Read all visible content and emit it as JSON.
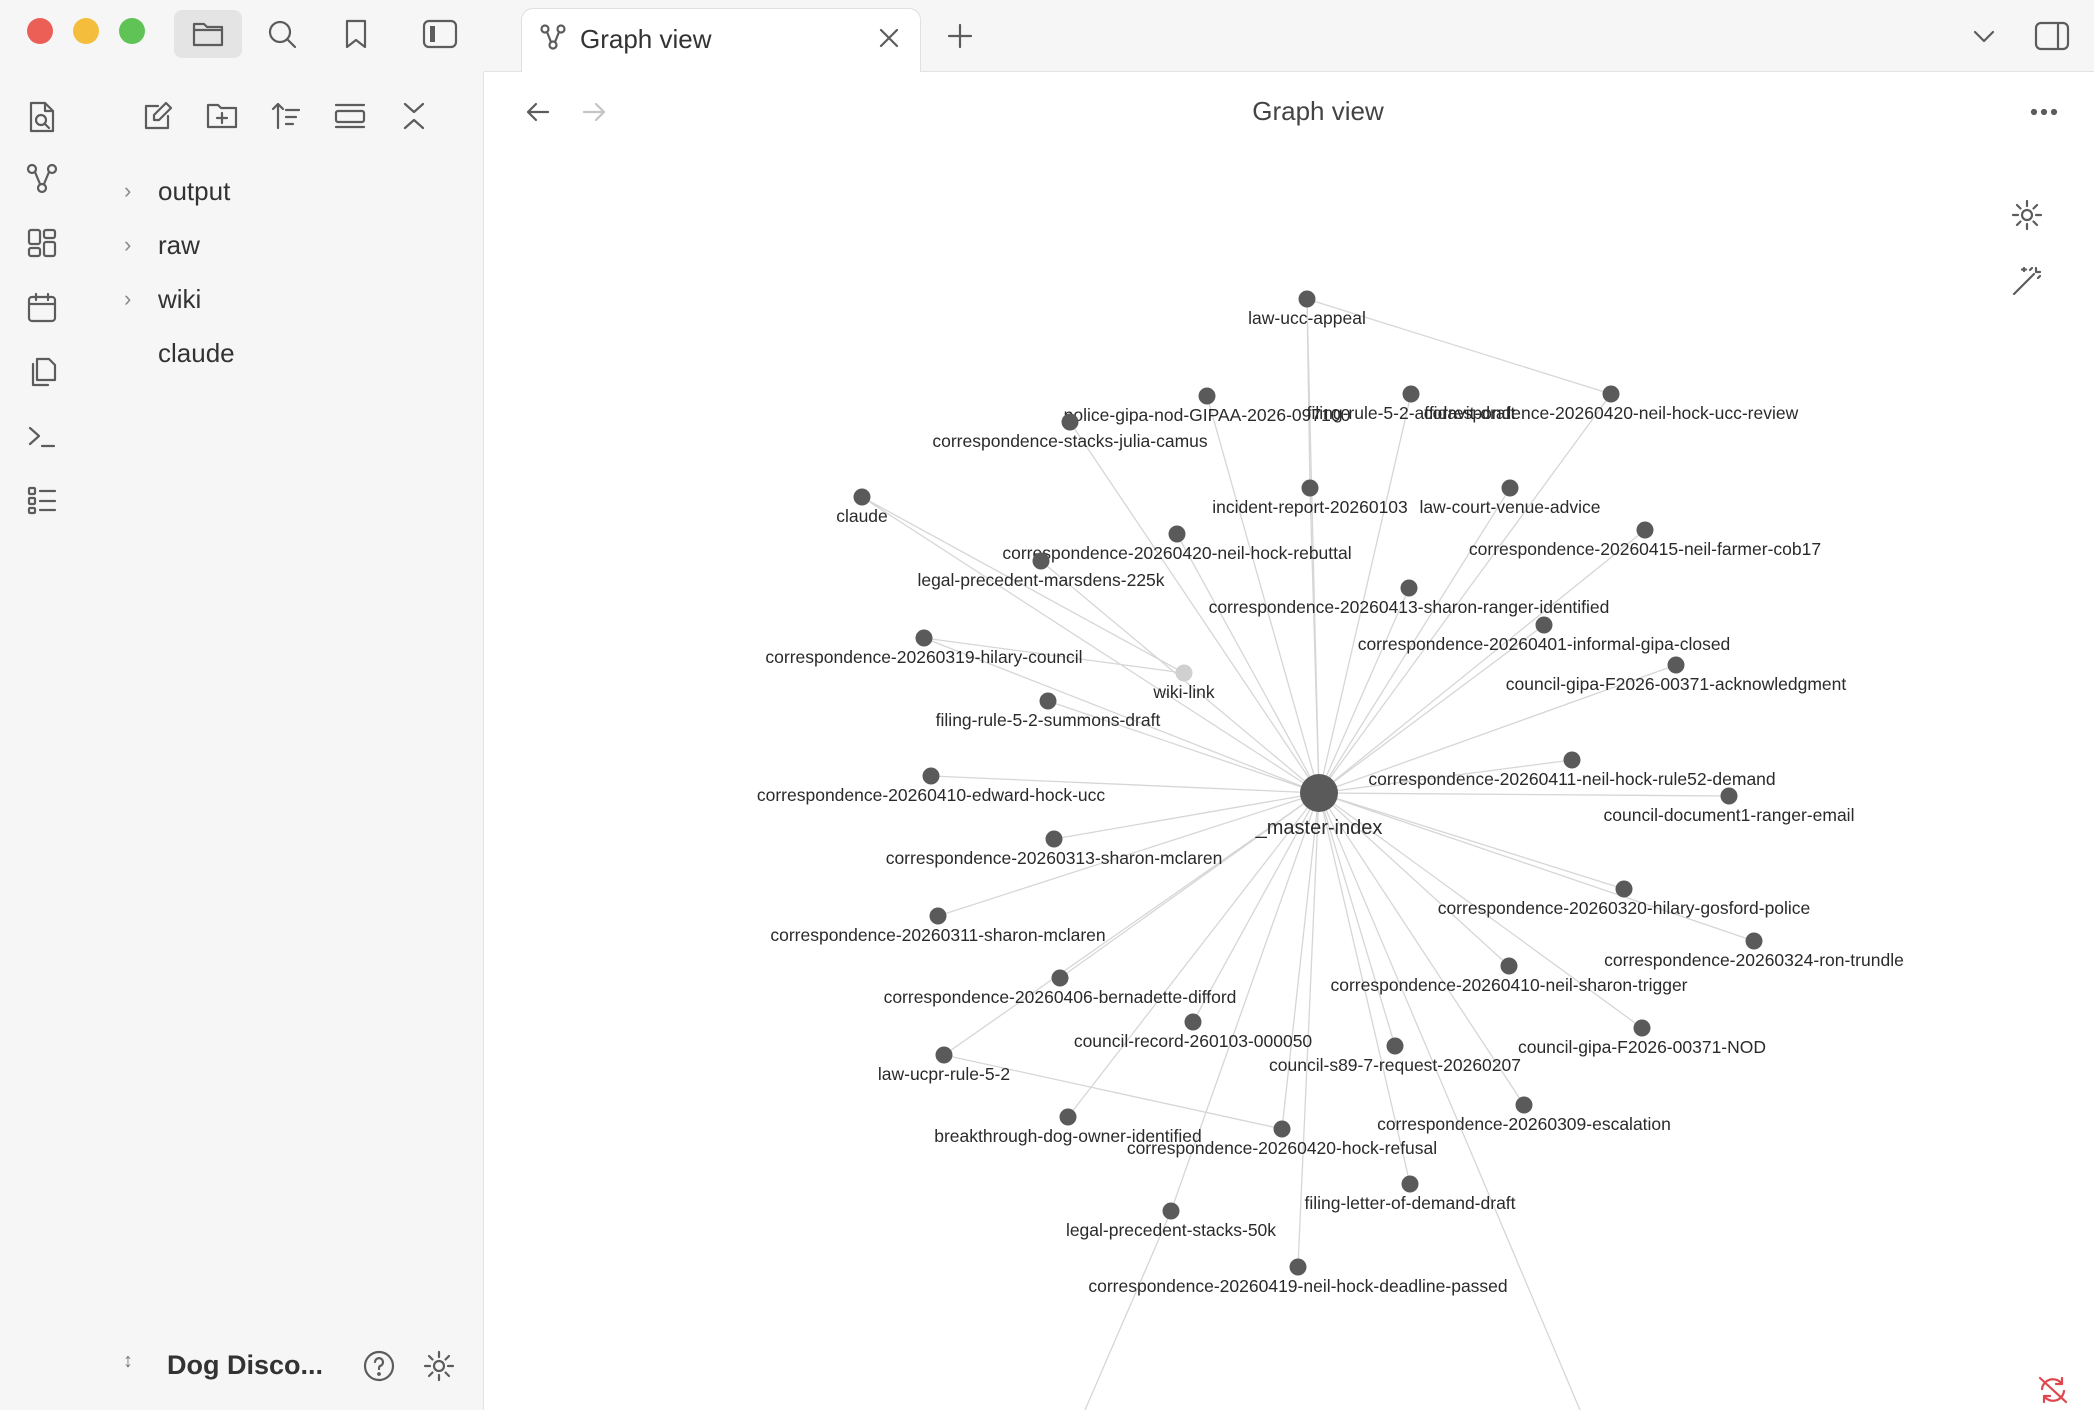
{
  "window": {
    "traffic_lights": {
      "close": "#ec5f57",
      "minimize": "#f4bd3c",
      "maximize": "#5fc455"
    }
  },
  "sidebar": {
    "tree": [
      {
        "label": "output",
        "folder": true
      },
      {
        "label": "raw",
        "folder": true
      },
      {
        "label": "wiki",
        "folder": true
      },
      {
        "label": "claude",
        "folder": false
      }
    ],
    "vault_name": "Dog Disco..."
  },
  "tab": {
    "title": "Graph view"
  },
  "view": {
    "title": "Graph view"
  },
  "icons": {
    "top_left": [
      "folder-icon",
      "search-icon",
      "bookmark-icon",
      "sidebar-toggle-icon"
    ],
    "ribbon": [
      "search-file-icon",
      "graph-icon",
      "canvas-icon",
      "calendar-icon",
      "copy-icon",
      "terminal-icon",
      "list-icon"
    ],
    "explorer_toolbar": [
      "new-note-icon",
      "new-folder-icon",
      "sort-icon",
      "collapse-view-icon",
      "collapse-all-icon"
    ]
  },
  "graph": {
    "center": "_master-index",
    "nodes": [
      {
        "label": "law-ucc-appeal"
      },
      {
        "label": "police-gipa-nod-GIPAA-2026-097100"
      },
      {
        "label": "filing-rule-5-2-affidavit-draft"
      },
      {
        "label": "correspondence-20260420-neil-hock-ucc-review"
      },
      {
        "label": "correspondence-stacks-julia-camus"
      },
      {
        "label": "incident-report-20260103"
      },
      {
        "label": "law-court-venue-advice"
      },
      {
        "label": "claude"
      },
      {
        "label": "correspondence-20260420-neil-hock-rebuttal"
      },
      {
        "label": "correspondence-20260415-neil-farmer-cob17"
      },
      {
        "label": "legal-precedent-marsdens-225k"
      },
      {
        "label": "correspondence-20260413-sharon-ranger-identified"
      },
      {
        "label": "correspondence-20260401-informal-gipa-closed"
      },
      {
        "label": "correspondence-20260319-hilary-council"
      },
      {
        "label": "wiki-link",
        "unresolved": true
      },
      {
        "label": "council-gipa-F2026-00371-acknowledgment"
      },
      {
        "label": "filing-rule-5-2-summons-draft"
      },
      {
        "label": "correspondence-20260411-neil-hock-rule52-demand"
      },
      {
        "label": "correspondence-20260410-edward-hock-ucc"
      },
      {
        "label": "council-document1-ranger-email"
      },
      {
        "label": "correspondence-20260313-sharon-mclaren"
      },
      {
        "label": "correspondence-20260320-hilary-gosford-police"
      },
      {
        "label": "correspondence-20260311-sharon-mclaren"
      },
      {
        "label": "correspondence-20260324-ron-trundle"
      },
      {
        "label": "correspondence-20260406-bernadette-difford"
      },
      {
        "label": "correspondence-20260410-neil-sharon-trigger"
      },
      {
        "label": "council-record-260103-000050"
      },
      {
        "label": "council-gipa-F2026-00371-NOD"
      },
      {
        "label": "council-s89-7-request-20260207"
      },
      {
        "label": "law-ucpr-rule-5-2"
      },
      {
        "label": "correspondence-20260309-escalation"
      },
      {
        "label": "breakthrough-dog-owner-identified"
      },
      {
        "label": "correspondence-20260420-hock-refusal"
      },
      {
        "label": "filing-letter-of-demand-draft"
      },
      {
        "label": "legal-precedent-stacks-50k"
      },
      {
        "label": "correspondence-20260419-neil-hock-deadline-passed"
      }
    ]
  },
  "colors": {
    "node": "#5a5a5a",
    "node_unresolved": "#d0d0d0",
    "edge": "#d6d6d6",
    "sync_icon": "#e0474c"
  }
}
